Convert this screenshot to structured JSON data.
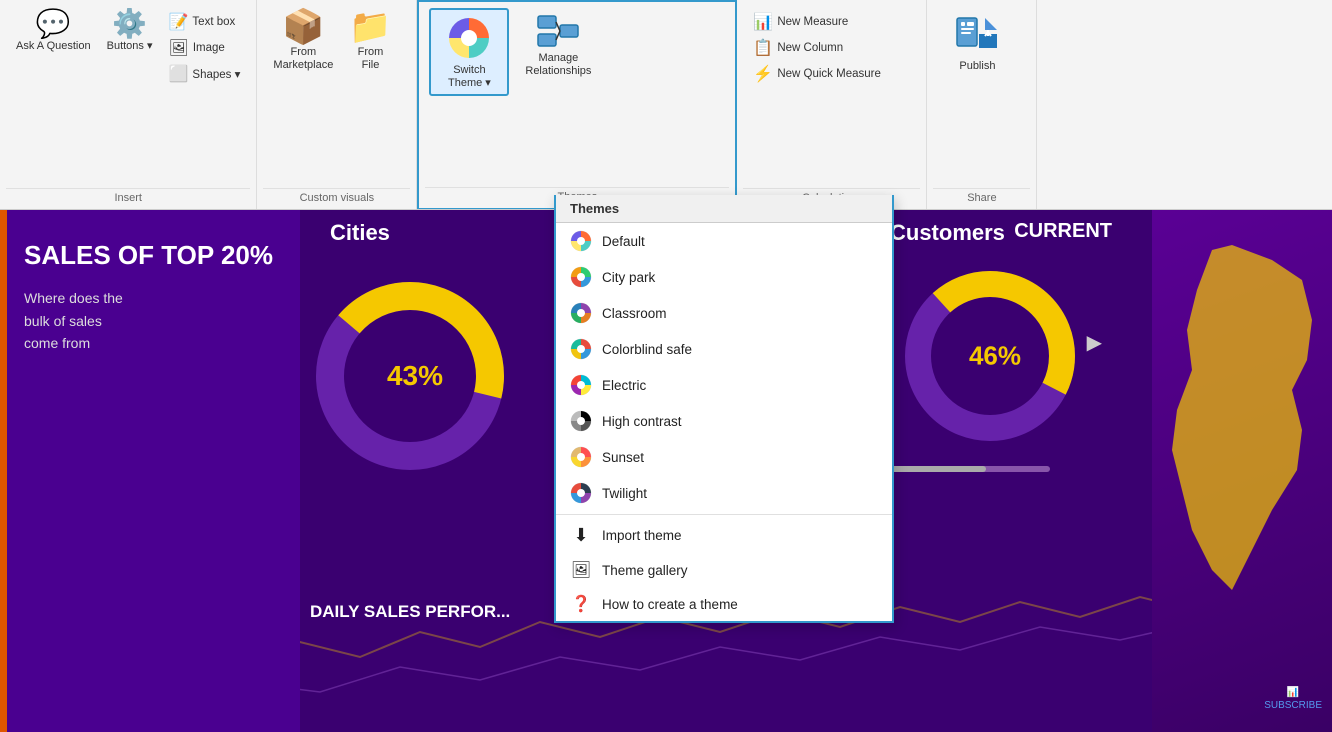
{
  "toolbar": {
    "sections": {
      "insert": {
        "label": "Insert",
        "items": [
          {
            "id": "ask-question",
            "label": "Ask A\nQuestion",
            "icon": "💬"
          },
          {
            "id": "buttons",
            "label": "Buttons",
            "icon": "🔘"
          },
          {
            "id": "text-box",
            "label": "Text box",
            "icon": "📝"
          },
          {
            "id": "image",
            "label": "Image",
            "icon": "🖼"
          },
          {
            "id": "shapes",
            "label": "Shapes ▾",
            "icon": "⬜"
          }
        ]
      },
      "custom_visuals": {
        "label": "Custom visuals",
        "items": [
          {
            "id": "from-marketplace",
            "label": "From\nMarketplace",
            "icon": "📦"
          },
          {
            "id": "from-file",
            "label": "From\nFile",
            "icon": "📁"
          }
        ]
      },
      "themes": {
        "label": "Themes",
        "switch_theme": "Switch\nTheme ▾",
        "manage_relationships": "Manage\nRelationships"
      },
      "calculations": {
        "label": "Calculations",
        "items": [
          {
            "id": "new-measure",
            "label": "New Measure"
          },
          {
            "id": "new-column",
            "label": "New Column"
          },
          {
            "id": "new-quick-measure",
            "label": "New Quick Measure"
          }
        ]
      },
      "share": {
        "label": "Share",
        "publish": "Publish"
      }
    },
    "dropdown": {
      "header": "Themes",
      "items": [
        {
          "id": "default",
          "label": "Default"
        },
        {
          "id": "city-park",
          "label": "City park"
        },
        {
          "id": "classroom",
          "label": "Classroom"
        },
        {
          "id": "colorblind-safe",
          "label": "Colorblind safe"
        },
        {
          "id": "electric",
          "label": "Electric"
        },
        {
          "id": "high-contrast",
          "label": "High contrast"
        },
        {
          "id": "sunset",
          "label": "Sunset"
        },
        {
          "id": "twilight",
          "label": "Twilight"
        }
      ],
      "footer_items": [
        {
          "id": "import-theme",
          "label": "Import theme",
          "icon": "⬇"
        },
        {
          "id": "theme-gallery",
          "label": "Theme gallery",
          "icon": "🖼"
        },
        {
          "id": "how-to-create",
          "label": "How to create a theme",
          "icon": "❓"
        }
      ]
    }
  },
  "dashboard": {
    "sales_title": "SALES OF\nTOP 20%",
    "sales_desc": "Where does the\nbulk of sales\ncome from",
    "cities_title": "Cities",
    "cities_percent": "43%",
    "customers_title": "Customers",
    "customers_percent": "46%",
    "current_label": "CURRENT",
    "daily_sales": "DAILY SALES PERFOR..."
  }
}
